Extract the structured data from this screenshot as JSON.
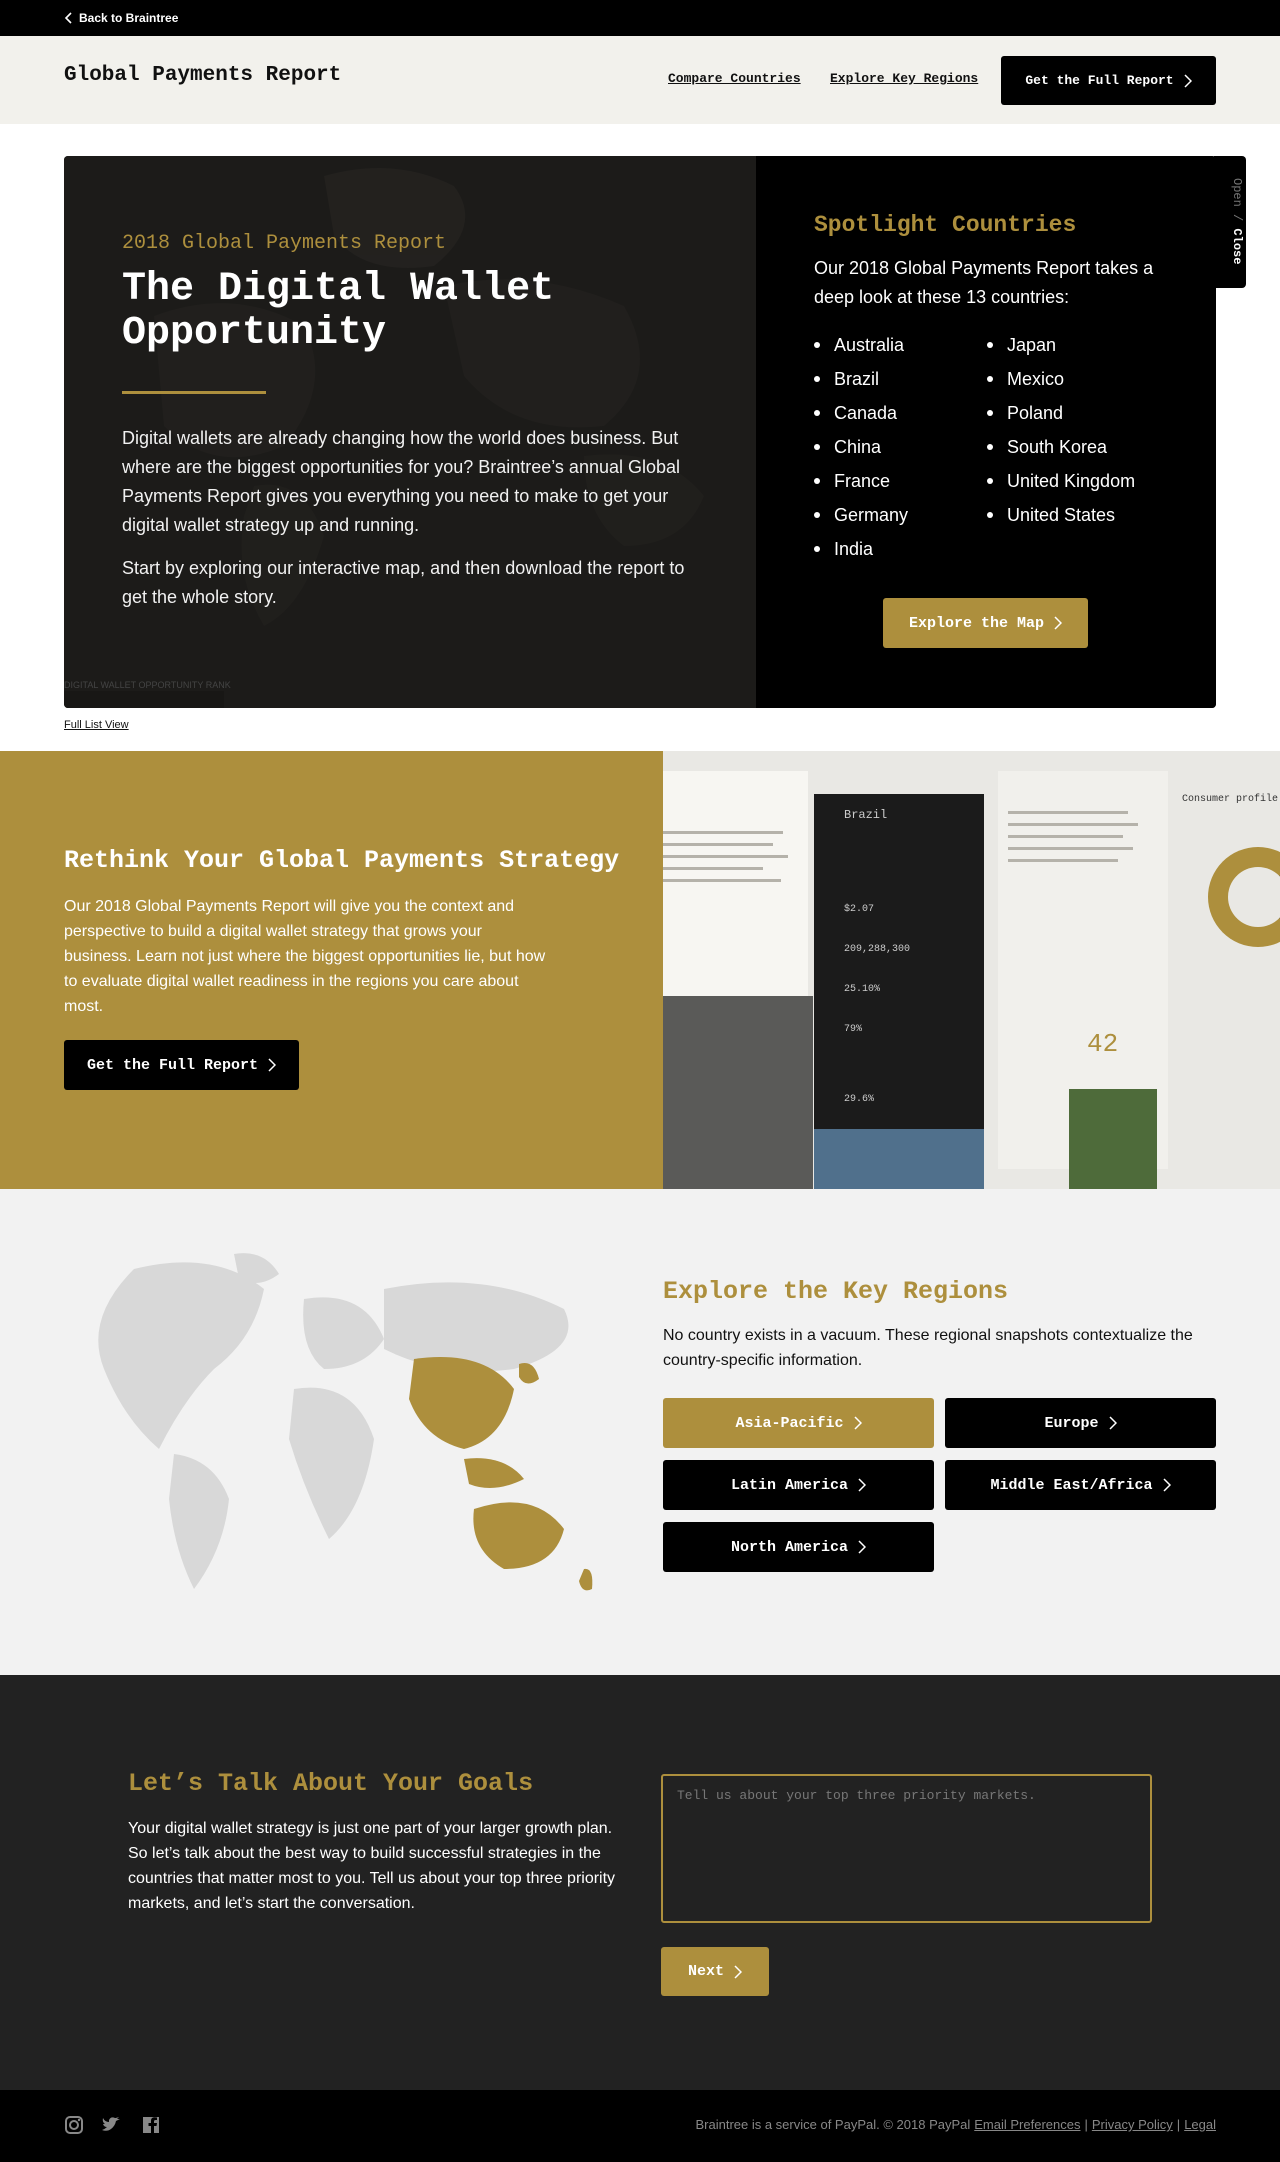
{
  "topbar": {
    "back_label": "Back to Braintree"
  },
  "header": {
    "title": "Global Payments Report",
    "nav": {
      "compare": "Compare Countries",
      "regions": "Explore Key Regions"
    },
    "cta": "Get the Full Report"
  },
  "hero": {
    "kicker": "2018 Global Payments Report",
    "title": "The Digital Wallet Opportunity",
    "p1": "Digital wallets are already changing how the world does business. But where are the biggest opportunities for you? Braintree’s annual Global Payments Report gives you everything you need to make to get your digital wallet strategy up and running.",
    "p2": "Start by exploring our interactive map, and then download the report to get the whole story.",
    "caption": "DIGITAL WALLET OPPORTUNITY RANK"
  },
  "spotlight": {
    "title": "Spotlight Countries",
    "desc": "Our 2018 Global Payments Report takes a deep look at these 13 countries:",
    "countries_a": [
      "Australia",
      "Brazil",
      "Canada",
      "China",
      "France",
      "Germany",
      "India"
    ],
    "countries_b": [
      "Japan",
      "Mexico",
      "Poland",
      "South Korea",
      "United Kingdom",
      "United States"
    ],
    "cta": "Explore the Map",
    "toggle_open": "Open",
    "toggle_sep": " / ",
    "toggle_close": "Close"
  },
  "full_list": "Full List View",
  "strategy": {
    "title": "Rethink Your Global Payments Strategy",
    "text": "Our 2018 Global Payments Report will give you the context and perspective to build a digital wallet strategy that grows your business. Learn not just where the biggest opportunities lie, but how to evaluate digital wallet readiness in the regions you care about most.",
    "cta": "Get the Full Report"
  },
  "preview": {
    "country": "Brazil",
    "consumer": "Consumer profile",
    "rank": "42",
    "stats": [
      "$2.07",
      "209,288,300",
      "25.10%",
      "79%",
      "29.6%"
    ]
  },
  "regions": {
    "title": "Explore the Key Regions",
    "desc": "No country exists in a vacuum. These regional snapshots contextualize the country-specific information.",
    "buttons": [
      "Asia-Pacific",
      "Europe",
      "Latin America",
      "Middle East/Africa",
      "North America"
    ],
    "highlight_color": "#ad8f3d"
  },
  "talk": {
    "title": "Let’s Talk About Your Goals",
    "text": "Your digital wallet strategy is just one part of your larger growth plan. So let’s talk about the best way to build successful strategies in the countries that matter most to you. Tell us about your top three priority markets, and let’s start the conversation.",
    "placeholder": "Tell us about your top three priority markets.",
    "next": "Next"
  },
  "footer": {
    "text": "Braintree is a service of PayPal. © 2018 PayPal",
    "email_prefs": "Email Preferences",
    "sep": "|",
    "privacy": "Privacy Policy",
    "legal": "Legal",
    "icons": [
      "instagram-icon",
      "twitter-icon",
      "facebook-icon"
    ]
  },
  "colors": {
    "accent": "#ad8f3d",
    "dark": "#222222",
    "black": "#000000"
  }
}
